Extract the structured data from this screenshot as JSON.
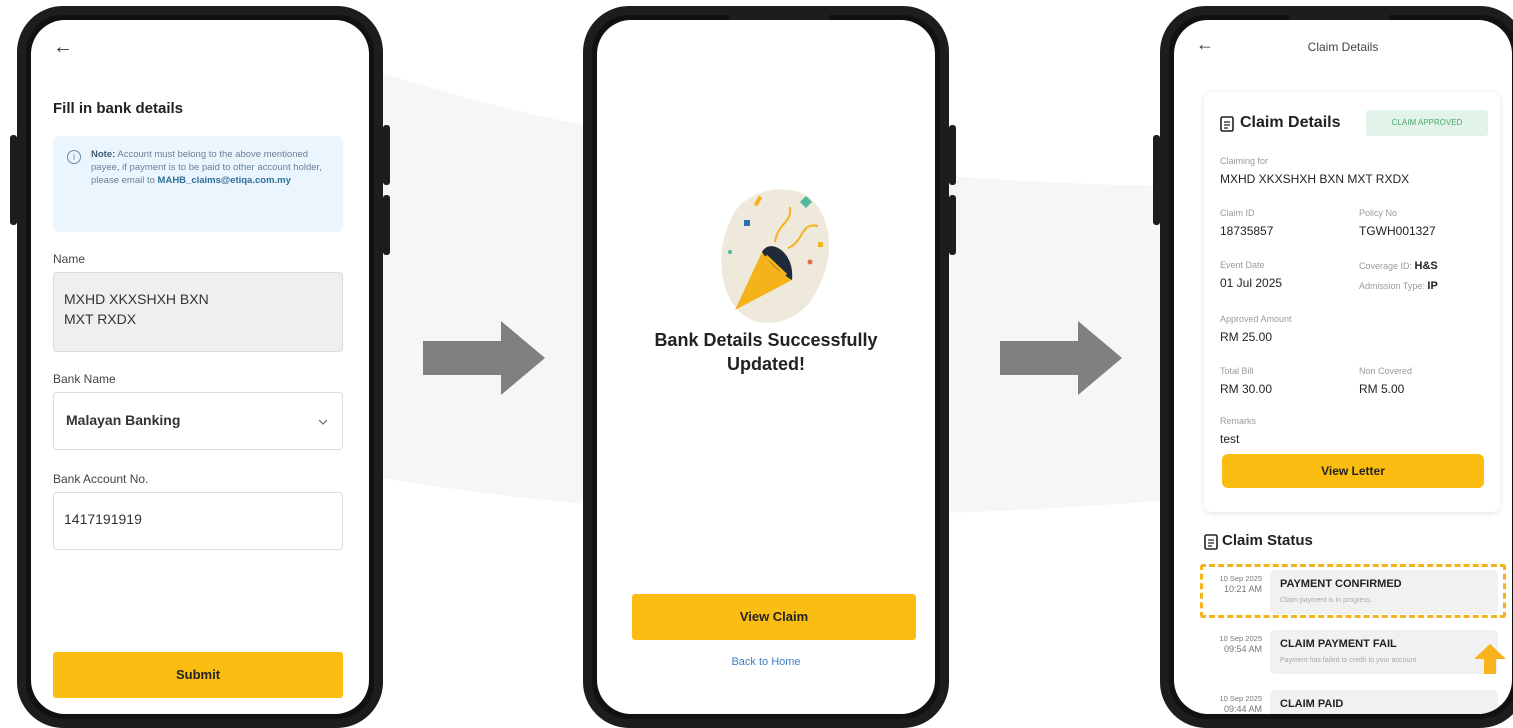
{
  "screen1": {
    "back_icon": "←",
    "title": "Fill in bank details",
    "note": {
      "bold": "Note:",
      "text": "Account must belong to the above mentioned payee, if payment is to be paid to other account holder, please email to",
      "email": "MAHB_claims@etiqa.com.my"
    },
    "name_label": "Name",
    "name_value": "MXHD XKXSHXH BXN MXT RXDX",
    "bank_name_label": "Bank Name",
    "bank_name_value": "Malayan Banking",
    "account_label": "Bank Account No.",
    "account_value": "1417191919",
    "submit_label": "Submit"
  },
  "screen2": {
    "success_line1": "Bank Details Successfully",
    "success_line2": "Updated!",
    "view_claim_label": "View Claim",
    "back_home_label": "Back to Home"
  },
  "screen3": {
    "back_icon": "←",
    "header_title": "Claim Details",
    "card_title": "Claim Details",
    "badge": "CLAIM APPROVED",
    "claiming_for_label": "Claiming for",
    "claiming_for_value": "MXHD XKXSHXH BXN MXT RXDX",
    "claim_id_label": "Claim ID",
    "claim_id_value": "18735857",
    "policy_no_label": "Policy No",
    "policy_no_value": "TGWH001327",
    "event_date_label": "Event Date",
    "event_date_value": "01 Jul 2025",
    "coverage_id_label": "Coverage ID:",
    "coverage_id_value": "H&S",
    "admission_type_label": "Admission Type:",
    "admission_type_value": "IP",
    "approved_amount_label": "Approved Amount",
    "approved_amount_value": "RM 25.00",
    "total_bill_label": "Total Bill",
    "total_bill_value": "RM 30.00",
    "non_covered_label": "Non Covered",
    "non_covered_value": "RM 5.00",
    "remarks_label": "Remarks",
    "remarks_value": "test",
    "view_letter_label": "View Letter",
    "claim_status_title": "Claim Status",
    "statuses": [
      {
        "date": "10 Sep 2025",
        "time": "10:21 AM",
        "title": "PAYMENT CONFIRMED",
        "desc": "Claim payment is in progress."
      },
      {
        "date": "10 Sep 2025",
        "time": "09:54 AM",
        "title": "CLAIM PAYMENT FAIL",
        "desc": "Payment has failed to credit to your account"
      },
      {
        "date": "10 Sep 2025",
        "time": "09:44 AM",
        "title": "CLAIM PAID",
        "desc": ""
      }
    ]
  },
  "colors": {
    "accent": "#fbbd12",
    "approved_bg": "#e2f3ea",
    "approved_text": "#48a76c",
    "highlight": "#f4b21b",
    "arrow": "#808080",
    "up_arrow": "#f7b21c"
  },
  "icons": {
    "info": "info-icon",
    "chevron": "chevron-down-icon",
    "document": "document-icon",
    "celebration": "party-popper-icon"
  }
}
